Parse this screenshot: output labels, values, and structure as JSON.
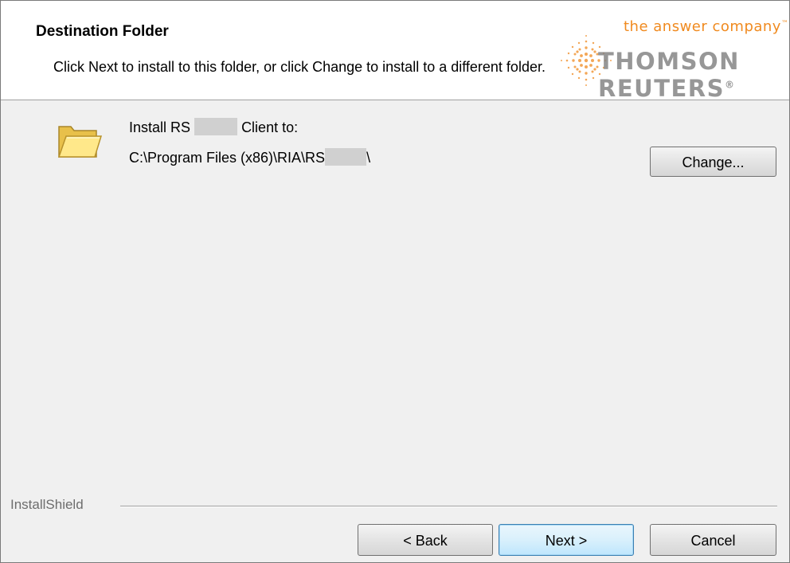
{
  "header": {
    "title": "Destination Folder",
    "subtitle": "Click Next to install to this folder, or click Change to install to a different folder.",
    "brand_tagline": "the answer company",
    "brand_tagline_mark": "™",
    "brand_name": "THOMSON REUTERS",
    "brand_name_mark": "®"
  },
  "content": {
    "install_label_prefix": "Install RS",
    "install_label_suffix": "Client to:",
    "install_path_prefix": "C:\\Program Files (x86)\\RIA\\RS",
    "install_path_suffix": "\\",
    "change_button": "Change..."
  },
  "footer": {
    "brand": "InstallShield",
    "back_button": "< Back",
    "next_button": "Next >",
    "cancel_button": "Cancel"
  },
  "colors": {
    "brand_orange": "#f08a1f",
    "brand_gray": "#858585",
    "dialog_background": "#f0f0f0",
    "header_background": "#ffffff",
    "default_button_border": "#3c7fb1"
  },
  "icons": {
    "folder": "folder-icon",
    "brand_mark": "thomson-reuters-dot-logo"
  }
}
